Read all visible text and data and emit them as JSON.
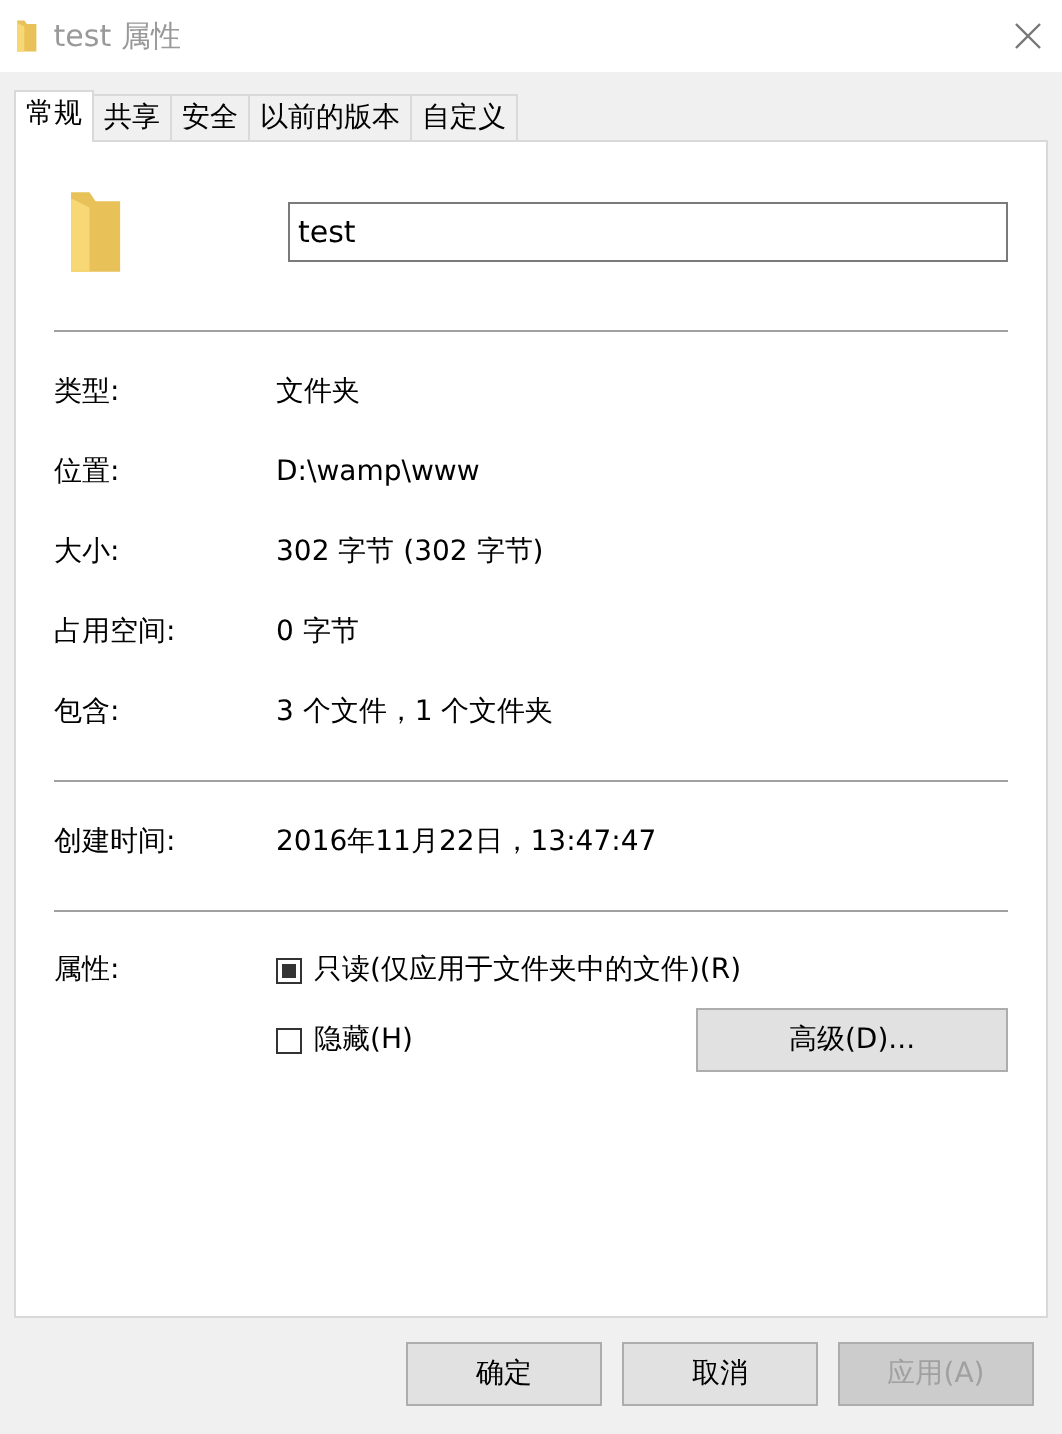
{
  "window": {
    "title": "test 属性"
  },
  "tabs": [
    {
      "label": "常规",
      "selected": true
    },
    {
      "label": "共享",
      "selected": false
    },
    {
      "label": "安全",
      "selected": false
    },
    {
      "label": "以前的版本",
      "selected": false
    },
    {
      "label": "自定义",
      "selected": false
    }
  ],
  "name_field": {
    "value": "test"
  },
  "info_groups": [
    [
      {
        "label": "类型:",
        "value": "文件夹"
      },
      {
        "label": "位置:",
        "value": "D:\\wamp\\www"
      },
      {
        "label": "大小:",
        "value": "302 字节 (302 字节)"
      },
      {
        "label": "占用空间:",
        "value": "0 字节"
      },
      {
        "label": "包含:",
        "value": "3 个文件，1 个文件夹"
      }
    ],
    [
      {
        "label": "创建时间:",
        "value": "2016年11月22日，13:47:47"
      }
    ]
  ],
  "attributes": {
    "label": "属性:",
    "options": [
      {
        "label": "只读(仅应用于文件夹中的文件)(R)",
        "checked": false,
        "indeterminate": true
      },
      {
        "label": "隐藏(H)",
        "checked": false,
        "indeterminate": false
      }
    ],
    "advanced_button": "高级(D)..."
  },
  "buttons": [
    {
      "label": "确定",
      "disabled": false
    },
    {
      "label": "取消",
      "disabled": false
    },
    {
      "label": "应用(A)",
      "disabled": true
    }
  ]
}
